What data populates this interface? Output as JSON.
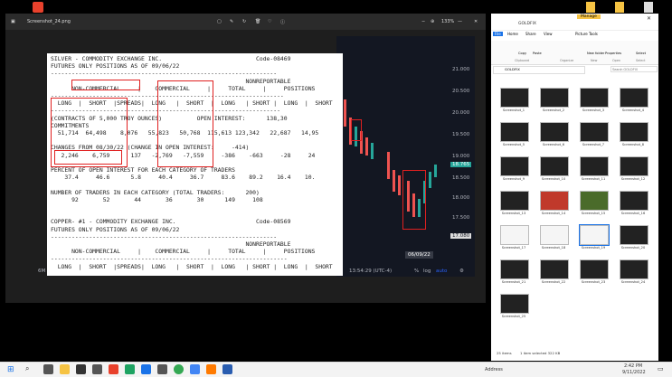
{
  "desktop": {
    "top_icons_color": "#f6c343"
  },
  "viewer": {
    "title": "Screenshot_24.png",
    "zoom": "133%",
    "toolbar": [
      "image-icon",
      "edit-icon",
      "rotate-icon",
      "delete-icon",
      "heart-icon",
      "info-icon",
      "share-icon",
      "minimize-icon",
      "maximize-icon",
      "close-icon"
    ]
  },
  "chart": {
    "prices": [
      "21.000",
      "20.500",
      "20.000",
      "19.500",
      "19.000",
      "18.500",
      "18.000",
      "17.500"
    ],
    "last_price": "18.765",
    "marker_price": "17.080",
    "date_label": "06/09/22",
    "footer": {
      "time": "13:54:29 (UTC-4)",
      "percent": "%",
      "log": "log",
      "auto": "auto",
      "left_label": "6M"
    }
  },
  "cot": {
    "lines": [
      "SILVER - COMMODITY EXCHANGE INC.                           Code-08469",
      "FUTURES ONLY POSITIONS AS OF 09/06/22",
      "-----------------------------------------------------------------",
      "                                                        NONREPORTABLE",
      "      NON-COMMERCIAL     |    COMMERCIAL     |     TOTAL     |     POSITIONS",
      "-------------------------------------------------------------------",
      "  LONG  |  SHORT  |SPREADS|  LONG   |  SHORT  |  LONG   | SHORT |  LONG  |  SHORT",
      "------------------------------------------------------------------",
      "(CONTRACTS OF 5,000 TROY OUNCES)          OPEN INTEREST:      138,30",
      "COMMITMENTS",
      "  51,714  64,498    8,076   55,823   50,768  115,613 123,342   22,687   14,95",
      "",
      "CHANGES FROM 08/30/22 (CHANGE IN OPEN INTEREST:     -414)",
      "   2,246    6,759      137   -2,769   -7,559     -386    -663     -28     24",
      "",
      "PERCENT OF OPEN INTEREST FOR EACH CATEGORY OF TRADERS",
      "    37.4     46.6      5.8     40.4     36.7     83.6    89.2    16.4    10.",
      "",
      "NUMBER OF TRADERS IN EACH CATEGORY (TOTAL TRADERS:      200)",
      "      92       52       44       36       30      149     108",
      "",
      "",
      "COPPER- #1 - COMMODITY EXCHANGE INC.                       Code-08569",
      "FUTURES ONLY POSITIONS AS OF 09/06/22",
      "-----------------------------------------------------------------",
      "                                                        NONREPORTABLE",
      "      NON-COMMERCIAL     |    COMMERCIAL     |     TOTAL     |     POSITIONS",
      "--------------------------------------------------------------------",
      "  LONG  |  SHORT  |SPREADS|  LONG   |  SHORT  |  LONG   | SHORT |  LONG  |  SHORT"
    ]
  },
  "explorer": {
    "tab_manage": "Manage",
    "tab_picture_tools": "Picture Tools",
    "folder": "GOLDFIX",
    "search_placeholder": "Search GOLDFIX",
    "ribbon": [
      "File",
      "Home",
      "Share",
      "View"
    ],
    "ribbon_groups": [
      "Clipboard",
      "Organize",
      "New",
      "Open",
      "Select"
    ],
    "ribbon_buttons": [
      "Copy",
      "Paste",
      "Move to",
      "Copy to",
      "Delete",
      "Rename",
      "New folder",
      "Properties",
      "Select"
    ],
    "thumbs": [
      "Screenshot_1",
      "Screenshot_2",
      "Screenshot_3",
      "Screenshot_4",
      "Screenshot_5",
      "Screenshot_6",
      "Screenshot_7",
      "Screenshot_8",
      "Screenshot_9",
      "Screenshot_10",
      "Screenshot_11",
      "Screenshot_12",
      "Screenshot_13",
      "Screenshot_14",
      "Screenshot_15",
      "Screenshot_16",
      "Screenshot_17",
      "Screenshot_18",
      "Screenshot_19",
      "Screenshot_20",
      "Screenshot_21",
      "Screenshot_22",
      "Screenshot_23",
      "Screenshot_24",
      "Screenshot_25"
    ],
    "status_items": "25 items",
    "status_selected": "1 item selected  322 KB"
  },
  "taskbar": {
    "search_label": "Address",
    "time": "2:42 PM",
    "date": "9/11/2022"
  }
}
